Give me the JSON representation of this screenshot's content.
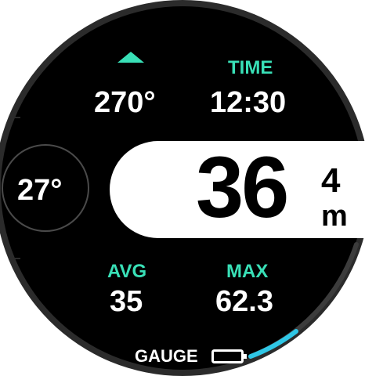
{
  "colors": {
    "accent": "#39e0b7",
    "progress": "#2fc7e6",
    "bezel": "#3a3a3a",
    "background": "#000000",
    "highlight": "#ffffff"
  },
  "heading": {
    "icon": "heading-arrow-icon",
    "value": "270°"
  },
  "time": {
    "label": "TIME",
    "value": "12:30"
  },
  "temperature": {
    "value": "27°"
  },
  "depth": {
    "value": "36",
    "decimal": "4",
    "unit": "m"
  },
  "avg": {
    "label": "AVG",
    "value": "35"
  },
  "max": {
    "label": "MAX",
    "value": "62.3"
  },
  "footer": {
    "mode": "GAUGE",
    "battery_icon": "battery-icon"
  }
}
